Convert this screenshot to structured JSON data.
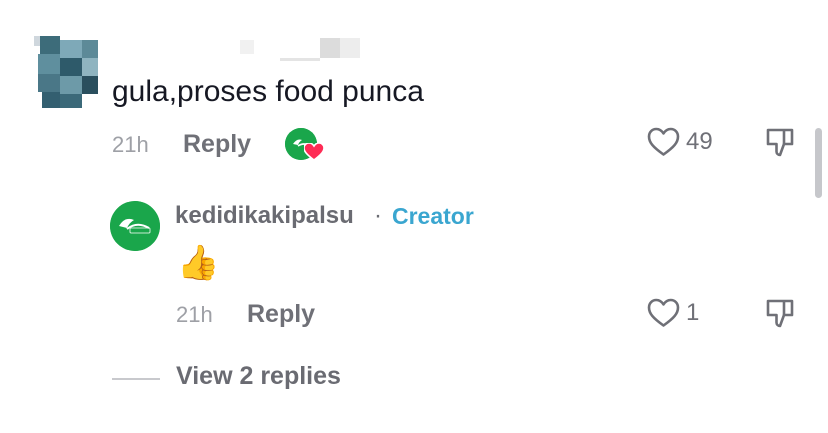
{
  "top_comment": {
    "text": "gula,proses food punca",
    "time": "21h",
    "reply_label": "Reply",
    "like_count": "49"
  },
  "reply_comment": {
    "username": "kedidikakipalsu",
    "separator": "·",
    "creator_label": "Creator",
    "text": "👍",
    "time": "21h",
    "reply_label": "Reply",
    "like_count": "1"
  },
  "view_replies_label": "View 2 replies",
  "colors": {
    "brand_green": "#1aa64b",
    "creator_blue": "#3aa6d0",
    "liked_heart": "#fe2c55"
  }
}
